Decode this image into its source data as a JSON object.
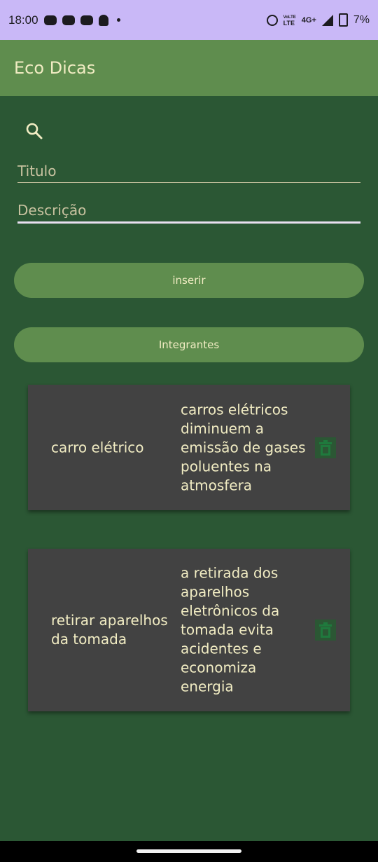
{
  "status_bar": {
    "time": "18:00",
    "network_top": "VoLTE",
    "network_bottom": "LTE",
    "network_type": "4G+",
    "battery": "7%",
    "icons": [
      "discord-icon",
      "discord-icon",
      "discord-icon",
      "snapchat-icon",
      "dot-icon",
      "alarm-icon",
      "volte-icon",
      "signal-icon",
      "battery-icon"
    ]
  },
  "app_bar": {
    "title": "Eco Dicas"
  },
  "search": {
    "icon": "search-icon"
  },
  "form": {
    "title_placeholder": "Titulo",
    "title_value": "",
    "description_placeholder": "Descrição",
    "description_value": ""
  },
  "buttons": {
    "insert_label": "inserir",
    "members_label": "Integrantes"
  },
  "tips": [
    {
      "title": "carro elétrico",
      "description": "carros elétricos diminuem a emissão de gases poluentes na atmosfera",
      "action_icon": "trash-icon"
    },
    {
      "title": "retirar aparelhos da tomada",
      "description": "a retirada dos aparelhos eletrônicos da tomada evita acidentes e economiza energia",
      "action_icon": "trash-icon"
    }
  ],
  "colors": {
    "background": "#2b5734",
    "app_bar": "#5f8d4e",
    "button": "#5f8d4e",
    "card": "#424242",
    "text": "#f1ecc3",
    "status_bar": "#c9b8f7",
    "delete_icon": "#1f7a3d"
  }
}
